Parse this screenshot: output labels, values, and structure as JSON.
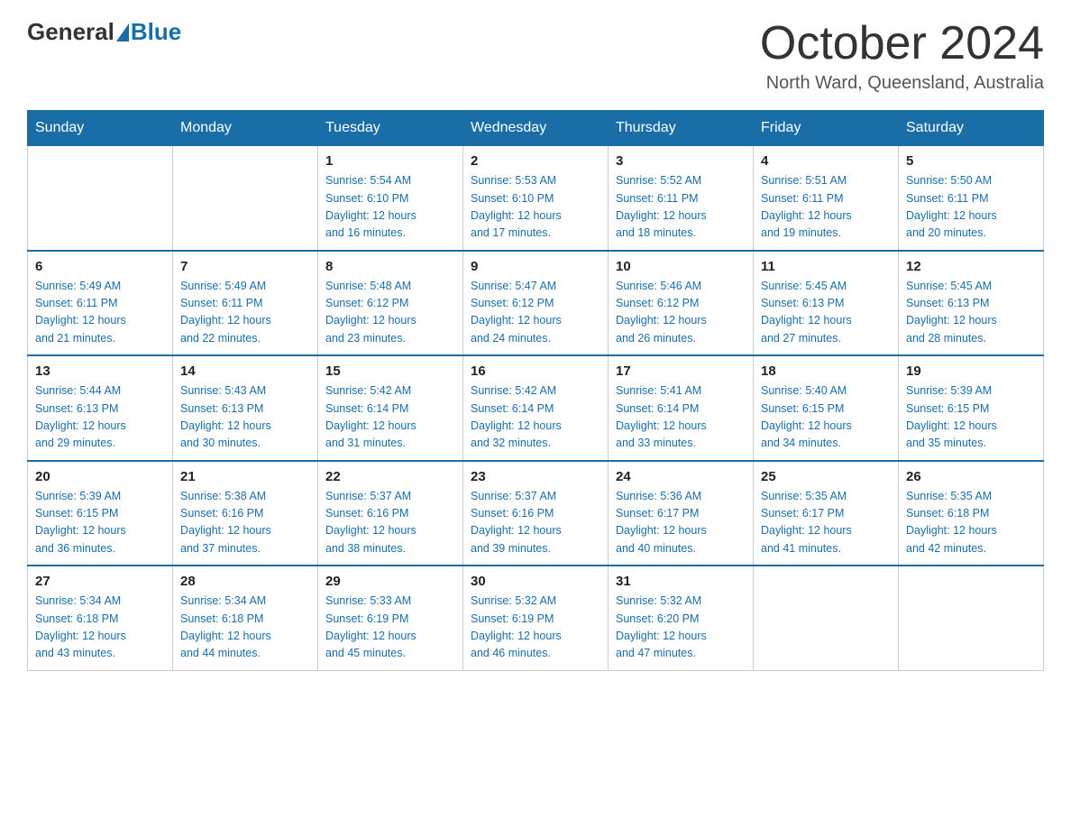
{
  "header": {
    "logo_general": "General",
    "logo_blue": "Blue",
    "title": "October 2024",
    "location": "North Ward, Queensland, Australia"
  },
  "days_of_week": [
    "Sunday",
    "Monday",
    "Tuesday",
    "Wednesday",
    "Thursday",
    "Friday",
    "Saturday"
  ],
  "weeks": [
    [
      {
        "day": "",
        "info": ""
      },
      {
        "day": "",
        "info": ""
      },
      {
        "day": "1",
        "info": "Sunrise: 5:54 AM\nSunset: 6:10 PM\nDaylight: 12 hours\nand 16 minutes."
      },
      {
        "day": "2",
        "info": "Sunrise: 5:53 AM\nSunset: 6:10 PM\nDaylight: 12 hours\nand 17 minutes."
      },
      {
        "day": "3",
        "info": "Sunrise: 5:52 AM\nSunset: 6:11 PM\nDaylight: 12 hours\nand 18 minutes."
      },
      {
        "day": "4",
        "info": "Sunrise: 5:51 AM\nSunset: 6:11 PM\nDaylight: 12 hours\nand 19 minutes."
      },
      {
        "day": "5",
        "info": "Sunrise: 5:50 AM\nSunset: 6:11 PM\nDaylight: 12 hours\nand 20 minutes."
      }
    ],
    [
      {
        "day": "6",
        "info": "Sunrise: 5:49 AM\nSunset: 6:11 PM\nDaylight: 12 hours\nand 21 minutes."
      },
      {
        "day": "7",
        "info": "Sunrise: 5:49 AM\nSunset: 6:11 PM\nDaylight: 12 hours\nand 22 minutes."
      },
      {
        "day": "8",
        "info": "Sunrise: 5:48 AM\nSunset: 6:12 PM\nDaylight: 12 hours\nand 23 minutes."
      },
      {
        "day": "9",
        "info": "Sunrise: 5:47 AM\nSunset: 6:12 PM\nDaylight: 12 hours\nand 24 minutes."
      },
      {
        "day": "10",
        "info": "Sunrise: 5:46 AM\nSunset: 6:12 PM\nDaylight: 12 hours\nand 26 minutes."
      },
      {
        "day": "11",
        "info": "Sunrise: 5:45 AM\nSunset: 6:13 PM\nDaylight: 12 hours\nand 27 minutes."
      },
      {
        "day": "12",
        "info": "Sunrise: 5:45 AM\nSunset: 6:13 PM\nDaylight: 12 hours\nand 28 minutes."
      }
    ],
    [
      {
        "day": "13",
        "info": "Sunrise: 5:44 AM\nSunset: 6:13 PM\nDaylight: 12 hours\nand 29 minutes."
      },
      {
        "day": "14",
        "info": "Sunrise: 5:43 AM\nSunset: 6:13 PM\nDaylight: 12 hours\nand 30 minutes."
      },
      {
        "day": "15",
        "info": "Sunrise: 5:42 AM\nSunset: 6:14 PM\nDaylight: 12 hours\nand 31 minutes."
      },
      {
        "day": "16",
        "info": "Sunrise: 5:42 AM\nSunset: 6:14 PM\nDaylight: 12 hours\nand 32 minutes."
      },
      {
        "day": "17",
        "info": "Sunrise: 5:41 AM\nSunset: 6:14 PM\nDaylight: 12 hours\nand 33 minutes."
      },
      {
        "day": "18",
        "info": "Sunrise: 5:40 AM\nSunset: 6:15 PM\nDaylight: 12 hours\nand 34 minutes."
      },
      {
        "day": "19",
        "info": "Sunrise: 5:39 AM\nSunset: 6:15 PM\nDaylight: 12 hours\nand 35 minutes."
      }
    ],
    [
      {
        "day": "20",
        "info": "Sunrise: 5:39 AM\nSunset: 6:15 PM\nDaylight: 12 hours\nand 36 minutes."
      },
      {
        "day": "21",
        "info": "Sunrise: 5:38 AM\nSunset: 6:16 PM\nDaylight: 12 hours\nand 37 minutes."
      },
      {
        "day": "22",
        "info": "Sunrise: 5:37 AM\nSunset: 6:16 PM\nDaylight: 12 hours\nand 38 minutes."
      },
      {
        "day": "23",
        "info": "Sunrise: 5:37 AM\nSunset: 6:16 PM\nDaylight: 12 hours\nand 39 minutes."
      },
      {
        "day": "24",
        "info": "Sunrise: 5:36 AM\nSunset: 6:17 PM\nDaylight: 12 hours\nand 40 minutes."
      },
      {
        "day": "25",
        "info": "Sunrise: 5:35 AM\nSunset: 6:17 PM\nDaylight: 12 hours\nand 41 minutes."
      },
      {
        "day": "26",
        "info": "Sunrise: 5:35 AM\nSunset: 6:18 PM\nDaylight: 12 hours\nand 42 minutes."
      }
    ],
    [
      {
        "day": "27",
        "info": "Sunrise: 5:34 AM\nSunset: 6:18 PM\nDaylight: 12 hours\nand 43 minutes."
      },
      {
        "day": "28",
        "info": "Sunrise: 5:34 AM\nSunset: 6:18 PM\nDaylight: 12 hours\nand 44 minutes."
      },
      {
        "day": "29",
        "info": "Sunrise: 5:33 AM\nSunset: 6:19 PM\nDaylight: 12 hours\nand 45 minutes."
      },
      {
        "day": "30",
        "info": "Sunrise: 5:32 AM\nSunset: 6:19 PM\nDaylight: 12 hours\nand 46 minutes."
      },
      {
        "day": "31",
        "info": "Sunrise: 5:32 AM\nSunset: 6:20 PM\nDaylight: 12 hours\nand 47 minutes."
      },
      {
        "day": "",
        "info": ""
      },
      {
        "day": "",
        "info": ""
      }
    ]
  ]
}
